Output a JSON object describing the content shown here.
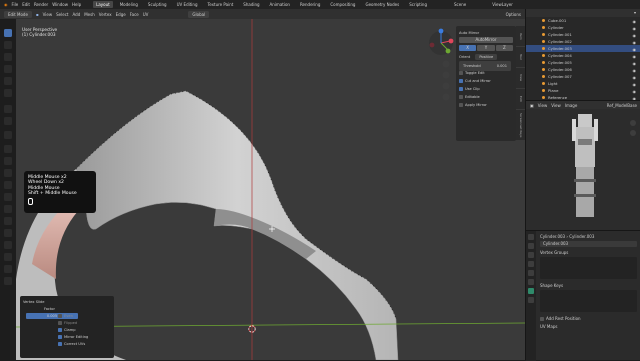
{
  "menu": {
    "items": [
      "File",
      "Edit",
      "Render",
      "Window",
      "Help"
    ],
    "workspaces": [
      "Layout",
      "Modeling",
      "Sculpting",
      "UV Editing",
      "Texture Paint",
      "Shading",
      "Animation",
      "Rendering",
      "Compositing",
      "Geometry Nodes",
      "Scripting"
    ],
    "active_workspace": "Layout",
    "scene": "Scene",
    "view_layer": "ViewLayer"
  },
  "viewport_header": {
    "mode": "Edit Mode",
    "menus": [
      "View",
      "Select",
      "Add",
      "Mesh",
      "Vertex",
      "Edge",
      "Face",
      "UV"
    ],
    "orientation": "Global",
    "options": "Options"
  },
  "viewport": {
    "view_name": "User Perspective",
    "object_name": "(1) Cylinder.003"
  },
  "keys_overlay": {
    "lines": [
      "Middle Mouse x2",
      "Wheel Down x2",
      "Middle Mouse",
      "Shift + Middle Mouse"
    ]
  },
  "auto_mirror": {
    "title": "Auto Mirror",
    "button": "AutoMirror",
    "axes": [
      "X",
      "Y",
      "Z"
    ],
    "orientation_label": "Orient",
    "orientation_value": "Positive",
    "threshold_label": "Threshold",
    "threshold_value": "0.001",
    "toggle_edit": "Toggle Edit",
    "cut_mirror": "Cut and Mirror",
    "use_clip": "Use Clip",
    "editable": "Editable",
    "apply_mirror": "Apply Mirror"
  },
  "side_tabs": [
    "Item",
    "Tool",
    "View",
    "Edit",
    "Screencast Keys"
  ],
  "redo_panel": {
    "title": "Vertex Slide",
    "factor_label": "Factor",
    "factor_value": "0.005",
    "even": "Even",
    "flipped": "Flipped",
    "clamp": "Clamp",
    "mirror_editing": "Mirror Editing",
    "correct_uvs": "Correct UVs"
  },
  "outliner": {
    "items": [
      {
        "name": "Cube.001",
        "selected": false
      },
      {
        "name": "Cylinder",
        "selected": false
      },
      {
        "name": "Cylinder.001",
        "selected": false
      },
      {
        "name": "Cylinder.002",
        "selected": false
      },
      {
        "name": "Cylinder.003",
        "selected": true
      },
      {
        "name": "Cylinder.004",
        "selected": false
      },
      {
        "name": "Cylinder.005",
        "selected": false
      },
      {
        "name": "Cylinder.006",
        "selected": false
      },
      {
        "name": "Cylinder.007",
        "selected": false
      },
      {
        "name": "Light",
        "selected": false
      },
      {
        "name": "Plane",
        "selected": false
      },
      {
        "name": "Reference",
        "selected": false
      }
    ]
  },
  "image_editor": {
    "menus": [
      "View",
      "View",
      "Image"
    ],
    "image_name": "Ref_ModelBase"
  },
  "properties": {
    "breadcrumb_a": "Cylinder.003",
    "breadcrumb_b": "Cylinder.003",
    "mesh_name": "Cylinder.003",
    "vertex_groups": "Vertex Groups",
    "shape_keys": "Shape Keys",
    "add_rest_position": "Add Rest Position",
    "uv_maps": "UV Maps"
  },
  "colors": {
    "accent": "#4772b3",
    "background": "#3a3a3a",
    "mesh": "#c9c9c9",
    "x_axis": "#e0455b",
    "y_axis": "#6da832",
    "z_axis": "#3a7ce0"
  }
}
